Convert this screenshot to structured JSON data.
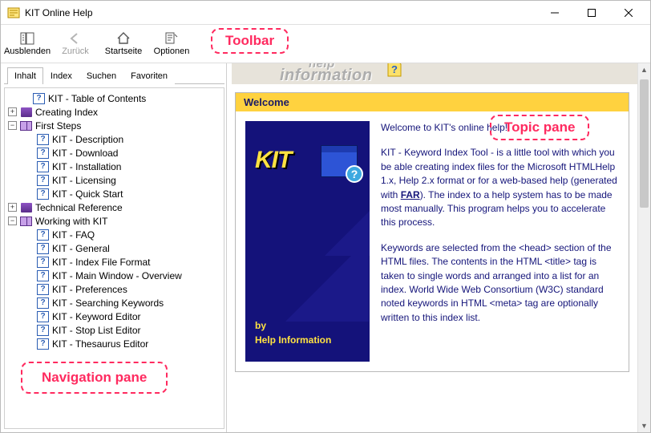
{
  "window": {
    "title": "KIT Online Help"
  },
  "toolbar": {
    "buttons": [
      {
        "id": "hide",
        "label": "Ausblenden"
      },
      {
        "id": "back",
        "label": "Zurück",
        "disabled": true
      },
      {
        "id": "home",
        "label": "Startseite"
      },
      {
        "id": "options",
        "label": "Optionen"
      }
    ]
  },
  "tabs": {
    "items": [
      {
        "id": "contents",
        "label": "Inhalt",
        "active": true
      },
      {
        "id": "index",
        "label": "Index"
      },
      {
        "id": "search",
        "label": "Suchen"
      },
      {
        "id": "favorites",
        "label": "Favoriten"
      }
    ]
  },
  "tree": {
    "toc": "KIT - Table of Contents",
    "creating_index": "Creating Index",
    "first_steps": "First Steps",
    "fs": {
      "desc": "KIT - Description",
      "download": "KIT - Download",
      "install": "KIT - Installation",
      "license": "KIT - Licensing",
      "quick": "KIT - Quick Start"
    },
    "tech_ref": "Technical Reference",
    "working": "Working with KIT",
    "wk": {
      "faq": "KIT - FAQ",
      "general": "KIT - General",
      "iff": "KIT - Index File Format",
      "main": "KIT - Main Window - Overview",
      "prefs": "KIT - Preferences",
      "search": "KIT - Searching Keywords",
      "kweditor": "KIT - Keyword Editor",
      "stoplist": "KIT - Stop List Editor",
      "thesaurus": "KIT - Thesaurus Editor"
    }
  },
  "topic": {
    "header_line1": "help",
    "header_line2": "information",
    "welcome": "Welcome",
    "logo_kit": "KIT",
    "logo_by": "by",
    "logo_company": "Help Information",
    "p1": "Welcome to KIT's online help!",
    "p2a": "KIT - Keyword Index Tool - is a little tool with which you be able creating index files for the Microsoft HTMLHelp 1.x, Help 2.x format or for a web-based help (generated with ",
    "p2link": "FAR",
    "p2b": "). The index to a help system has to be made most manually. This program helps you to accelerate this process.",
    "p3": "Keywords are selected from the <head> section of the HTML files. The contents in the HTML <title> tag is taken to single words and arranged into a list for an index. World Wide Web Consortium (W3C) standard noted keywords in HTML <meta> tag are optionally written to this index list."
  },
  "annotations": {
    "toolbar": "Toolbar",
    "navpane": "Navigation pane",
    "topicpane": "Topic pane"
  }
}
